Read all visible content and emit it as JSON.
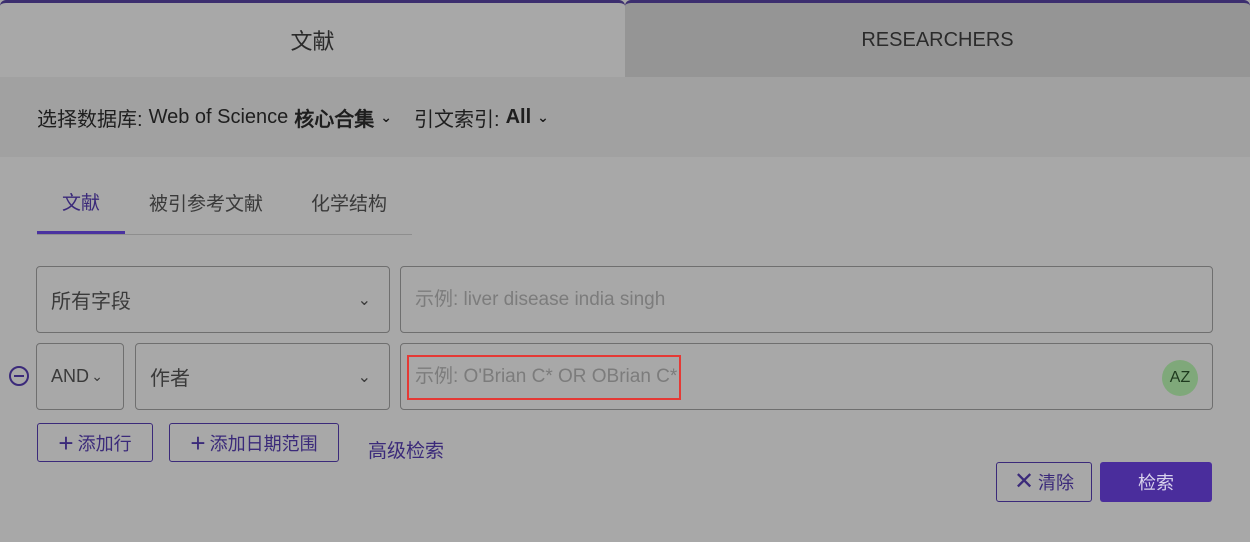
{
  "top_tabs": [
    {
      "label": "文献",
      "active": true
    },
    {
      "label": "RESEARCHERS",
      "active": false
    }
  ],
  "database_bar": {
    "db_label": "选择数据库:",
    "db_value_plain": "Web of Science",
    "db_value_bold": "核心合集",
    "index_label": "引文索引:",
    "index_value": "All"
  },
  "search_tabs": [
    {
      "label": "文献",
      "active": true
    },
    {
      "label": "被引参考文献",
      "active": false
    },
    {
      "label": "化学结构",
      "active": false
    }
  ],
  "rows": [
    {
      "field": "所有字段",
      "placeholder": "示例: liver disease india singh"
    },
    {
      "operator": "AND",
      "field": "作者",
      "placeholder": "示例: O'Brian C* OR OBrian C*",
      "az_label": "AZ"
    }
  ],
  "actions": {
    "add_row": "添加行",
    "add_date_range": "添加日期范围",
    "advanced_search": "高级检索",
    "clear": "清除",
    "search": "检索"
  },
  "colors": {
    "accent": "#4a2d9c",
    "highlight": "#e53935"
  }
}
